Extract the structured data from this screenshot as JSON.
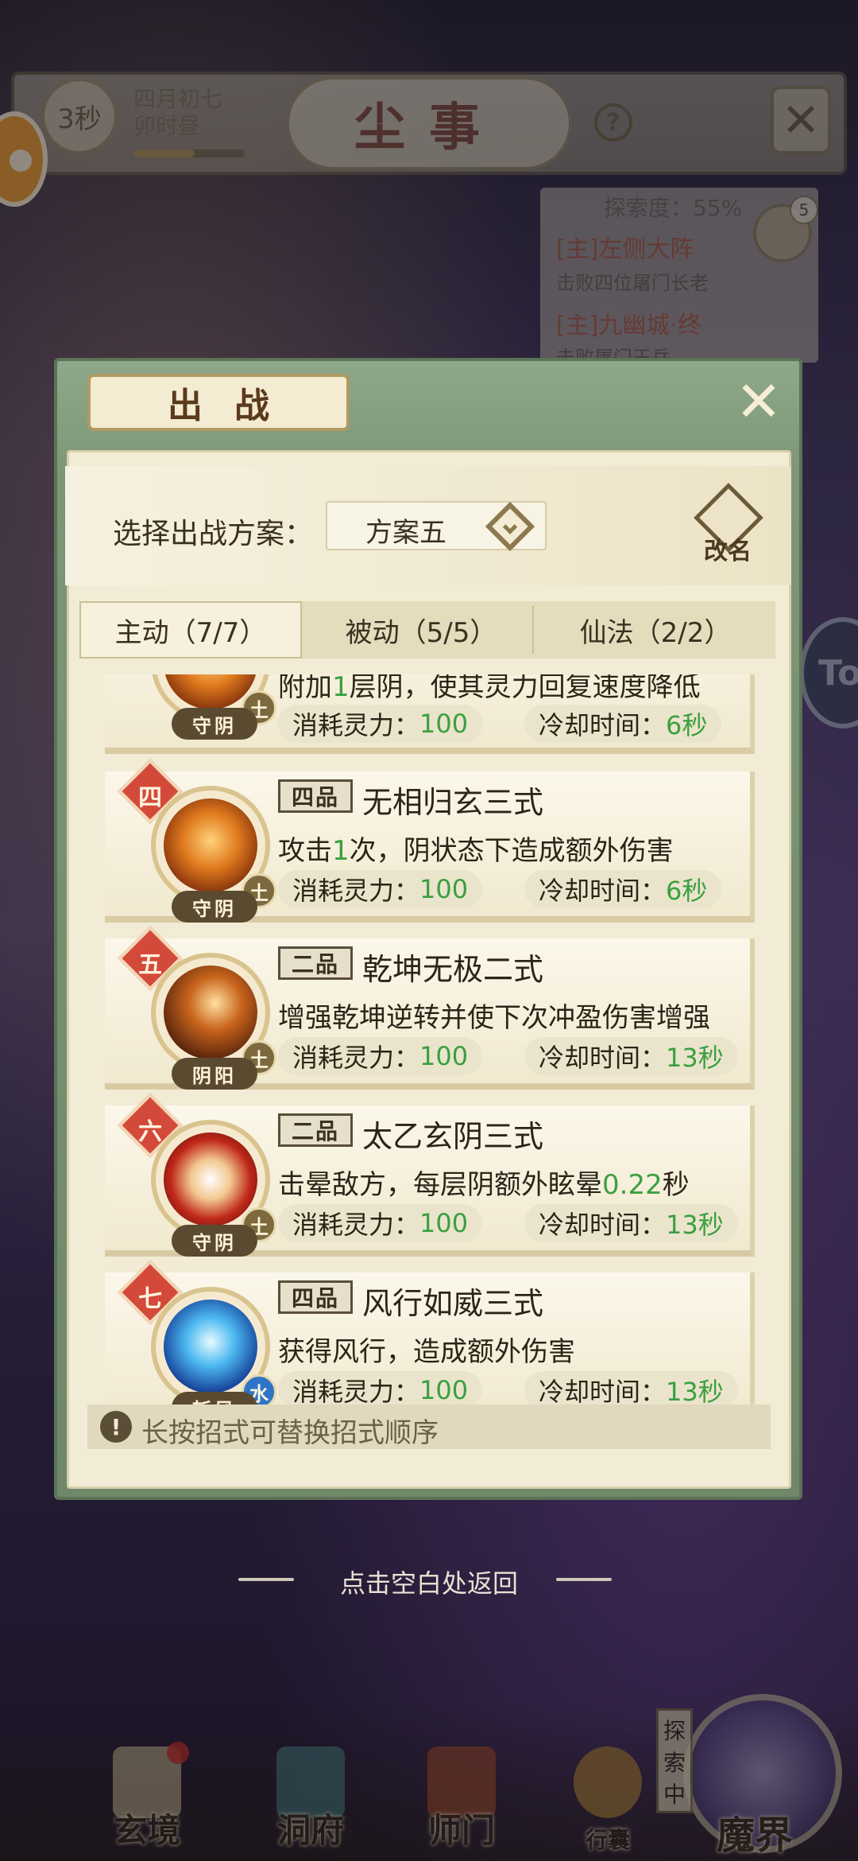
{
  "hud": {
    "timer": "3秒",
    "date_line1": "四月初七",
    "date_line2": "卯时昼",
    "title": "尘事",
    "help": "?",
    "close": "✕"
  },
  "quests": {
    "explore": "探索度：55%",
    "chat_count": "5",
    "items": [
      {
        "title": "[主]左侧大阵",
        "desc": "击败四位屠门长老"
      },
      {
        "title": "[主]九幽城·终",
        "desc": "击败屠门王岳"
      }
    ]
  },
  "side_badge": "To",
  "modal": {
    "title": "出战",
    "close": "✕",
    "scheme_label": "选择出战方案：",
    "scheme_value": "方案五",
    "rename": "改名",
    "tabs": [
      {
        "label": "主动（7/7）",
        "active": true
      },
      {
        "label": "被动（5/5）",
        "active": false
      },
      {
        "label": "仙法（2/2）",
        "active": false
      }
    ],
    "stat_cost_label": "消耗灵力：",
    "stat_cd_label": "冷却时间：",
    "skills": [
      {
        "index": "",
        "grade": "",
        "name": "",
        "desc_pre": "附加",
        "desc_hl": "1",
        "desc_post": "层阴，使其灵力回复速度降低",
        "cost": "100",
        "cd": "6秒",
        "stance": "守阴",
        "elem": "土",
        "icon": "fire"
      },
      {
        "index": "四",
        "grade": "四品",
        "name": "无相归玄三式",
        "desc_pre": "攻击",
        "desc_hl": "1",
        "desc_post": "次，阴状态下造成额外伤害",
        "cost": "100",
        "cd": "6秒",
        "stance": "守阴",
        "elem": "土",
        "icon": "fire"
      },
      {
        "index": "五",
        "grade": "二品",
        "name": "乾坤无极二式",
        "desc_pre": "增强乾坤逆转并使下次冲盈伤害增强",
        "desc_hl": "",
        "desc_post": "",
        "cost": "100",
        "cd": "13秒",
        "stance": "阴阳",
        "elem": "土",
        "icon": "shadow"
      },
      {
        "index": "六",
        "grade": "二品",
        "name": "太乙玄阴三式",
        "desc_pre": "击晕敌方，每层阴额外眩晕",
        "desc_hl": "0.22",
        "desc_post": "秒",
        "cost": "100",
        "cd": "13秒",
        "stance": "守阴",
        "elem": "土",
        "icon": "fan"
      },
      {
        "index": "七",
        "grade": "四品",
        "name": "风行如威三式",
        "desc_pre": "获得风行，造成额外伤害",
        "desc_hl": "",
        "desc_post": "",
        "cost": "100",
        "cd": "13秒",
        "stance": "斩风",
        "elem": "水",
        "icon": "wind"
      }
    ],
    "tip": "长按招式可替换招式顺序",
    "tip_icon": "!"
  },
  "return_hint": "点击空白处返回",
  "bottom_nav": {
    "items": [
      "玄境",
      "洞府",
      "师门",
      "行囊"
    ],
    "explore_tag": "探索中",
    "demon": "魔界"
  },
  "colors": {
    "accent_green": "#3aa040",
    "badge_red": "#d44a3a",
    "modal_green": "#7c9777",
    "panel_cream": "#f2ecd6"
  }
}
